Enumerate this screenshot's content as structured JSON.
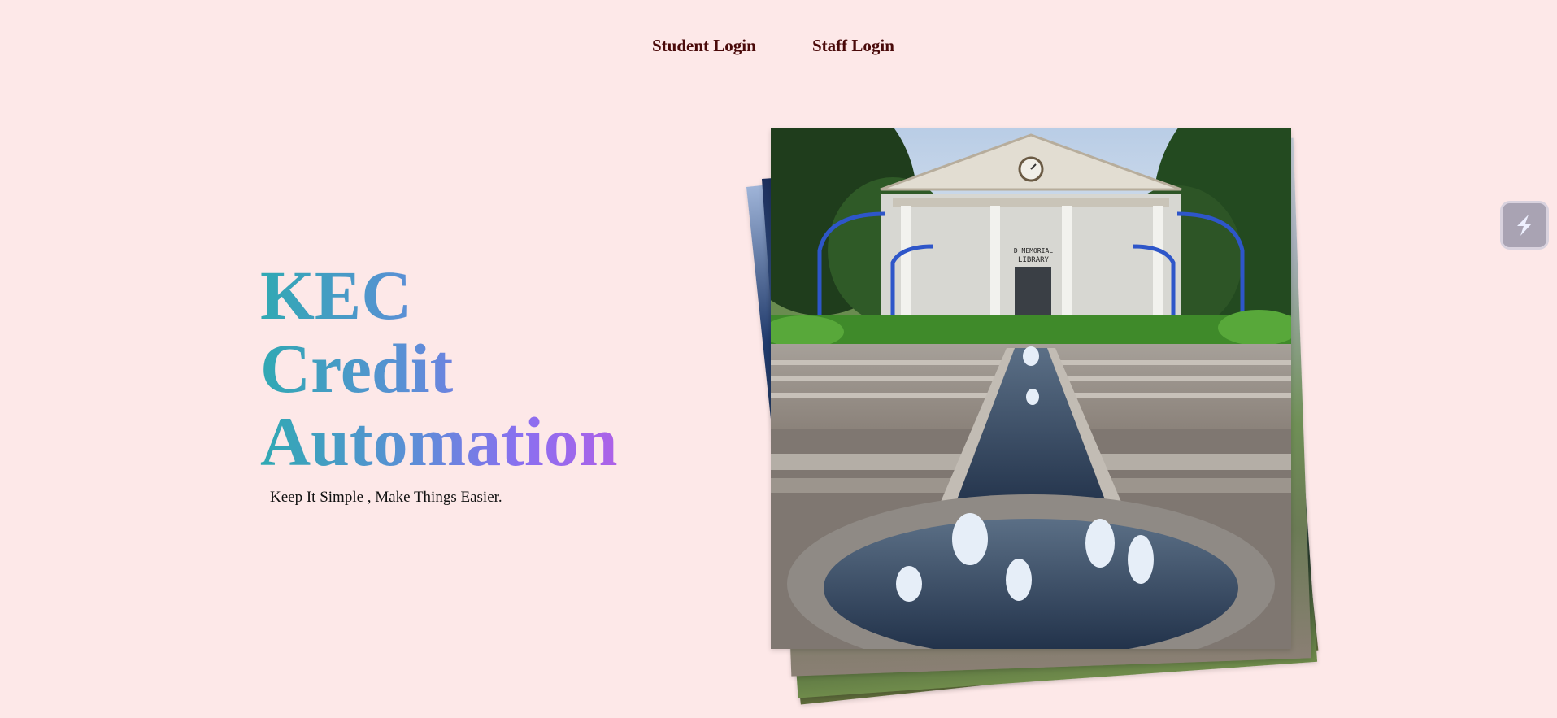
{
  "nav": {
    "student_login": "Student Login",
    "staff_login": "Staff Login"
  },
  "hero": {
    "line1": "KEC",
    "line2": "Credit",
    "line3": "Automation",
    "tagline": "Keep It Simple , Make Things Easier."
  },
  "photo": {
    "building_sign_line1": "D MEMORIAL",
    "building_sign_line2": "LIBRARY"
  },
  "widget": {
    "icon": "lightning-icon"
  },
  "colors": {
    "background": "#fde8e8",
    "nav_text": "#4a0a0a",
    "gradient_start": "#30a9b3",
    "gradient_end": "#b45fe6"
  }
}
